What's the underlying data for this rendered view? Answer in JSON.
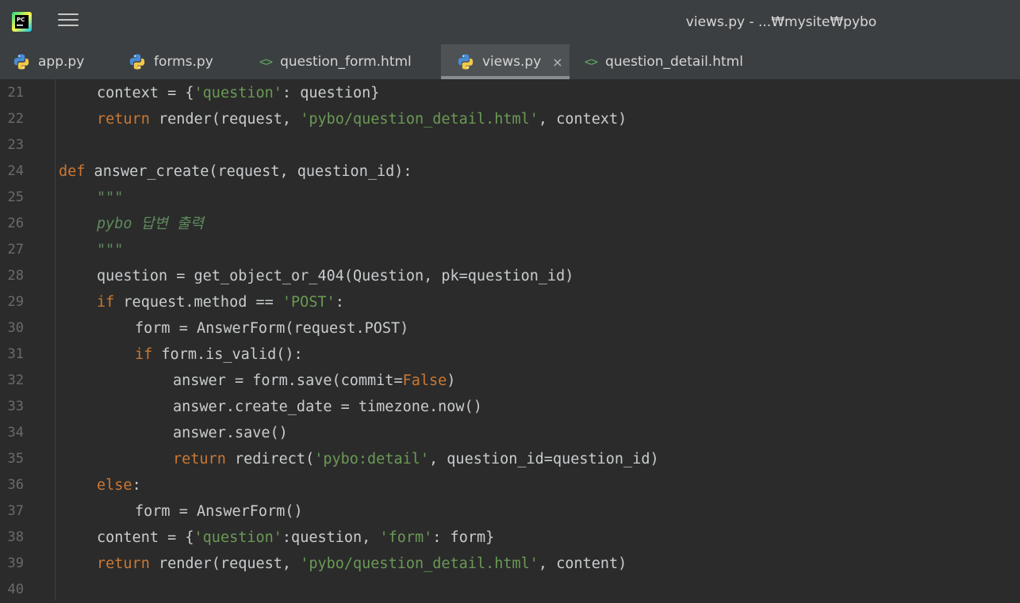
{
  "window": {
    "title": "views.py - ...₩mysite₩pybo"
  },
  "tabs": [
    {
      "label": "app.py",
      "icon": "python-file-icon",
      "active": false
    },
    {
      "label": "forms.py",
      "icon": "python-file-icon",
      "active": false
    },
    {
      "label": "question_form.html",
      "icon": "html-file-icon",
      "active": false
    },
    {
      "label": "views.py",
      "icon": "python-file-icon",
      "active": true,
      "close": "×"
    },
    {
      "label": "question_detail.html",
      "icon": "html-file-icon",
      "active": false
    }
  ],
  "html_icon_glyph": "<>",
  "colors": {
    "keyword": "#cc7832",
    "string": "#6a9955",
    "docstring": "#5f8a5f",
    "text": "#c9ccce",
    "background": "#2b2b2b"
  },
  "code": [
    {
      "n": "21",
      "indent": 1,
      "tokens": [
        [
          "t",
          "context = {"
        ],
        [
          "s",
          "'question'"
        ],
        [
          "t",
          ": question}"
        ]
      ]
    },
    {
      "n": "22",
      "indent": 1,
      "tokens": [
        [
          "k",
          "return"
        ],
        [
          "t",
          " render(request, "
        ],
        [
          "s",
          "'pybo/question_detail.html'"
        ],
        [
          "t",
          ", context)"
        ]
      ]
    },
    {
      "n": "23",
      "indent": 0,
      "tokens": []
    },
    {
      "n": "24",
      "indent": 0,
      "tokens": [
        [
          "k",
          "def"
        ],
        [
          "t",
          " answer_create(request, question_id):"
        ]
      ]
    },
    {
      "n": "25",
      "indent": 1,
      "tokens": [
        [
          "c",
          "\"\"\""
        ]
      ]
    },
    {
      "n": "26",
      "indent": 1,
      "tokens": [
        [
          "c",
          "pybo 답변 출력"
        ]
      ]
    },
    {
      "n": "27",
      "indent": 1,
      "tokens": [
        [
          "c",
          "\"\"\""
        ]
      ]
    },
    {
      "n": "28",
      "indent": 1,
      "tokens": [
        [
          "t",
          "question = get_object_or_404(Question, pk=question_id)"
        ]
      ]
    },
    {
      "n": "29",
      "indent": 1,
      "tokens": [
        [
          "k",
          "if"
        ],
        [
          "t",
          " request.method == "
        ],
        [
          "s",
          "'POST'"
        ],
        [
          "t",
          ":"
        ]
      ]
    },
    {
      "n": "30",
      "indent": 2,
      "tokens": [
        [
          "t",
          "form = AnswerForm(request.POST)"
        ]
      ]
    },
    {
      "n": "31",
      "indent": 2,
      "tokens": [
        [
          "k",
          "if"
        ],
        [
          "t",
          " form.is_valid():"
        ]
      ]
    },
    {
      "n": "32",
      "indent": 3,
      "tokens": [
        [
          "t",
          "answer = form.save(commit="
        ],
        [
          "k",
          "False"
        ],
        [
          "t",
          ")"
        ]
      ]
    },
    {
      "n": "33",
      "indent": 3,
      "tokens": [
        [
          "t",
          "answer.create_date = timezone.now()"
        ]
      ]
    },
    {
      "n": "34",
      "indent": 3,
      "tokens": [
        [
          "t",
          "answer.save()"
        ]
      ]
    },
    {
      "n": "35",
      "indent": 3,
      "tokens": [
        [
          "k",
          "return"
        ],
        [
          "t",
          " redirect("
        ],
        [
          "s",
          "'pybo:detail'"
        ],
        [
          "t",
          ", question_id=question_id)"
        ]
      ]
    },
    {
      "n": "36",
      "indent": 1,
      "tokens": [
        [
          "k",
          "else"
        ],
        [
          "t",
          ":"
        ]
      ]
    },
    {
      "n": "37",
      "indent": 2,
      "tokens": [
        [
          "t",
          "form = AnswerForm()"
        ]
      ]
    },
    {
      "n": "38",
      "indent": 1,
      "tokens": [
        [
          "t",
          "content = {"
        ],
        [
          "s",
          "'question'"
        ],
        [
          "t",
          ":question, "
        ],
        [
          "s",
          "'form'"
        ],
        [
          "t",
          ": form}"
        ]
      ]
    },
    {
      "n": "39",
      "indent": 1,
      "tokens": [
        [
          "k",
          "return"
        ],
        [
          "t",
          " render(request, "
        ],
        [
          "s",
          "'pybo/question_detail.html'"
        ],
        [
          "t",
          ", content)"
        ]
      ]
    },
    {
      "n": "40",
      "indent": 0,
      "tokens": []
    }
  ]
}
